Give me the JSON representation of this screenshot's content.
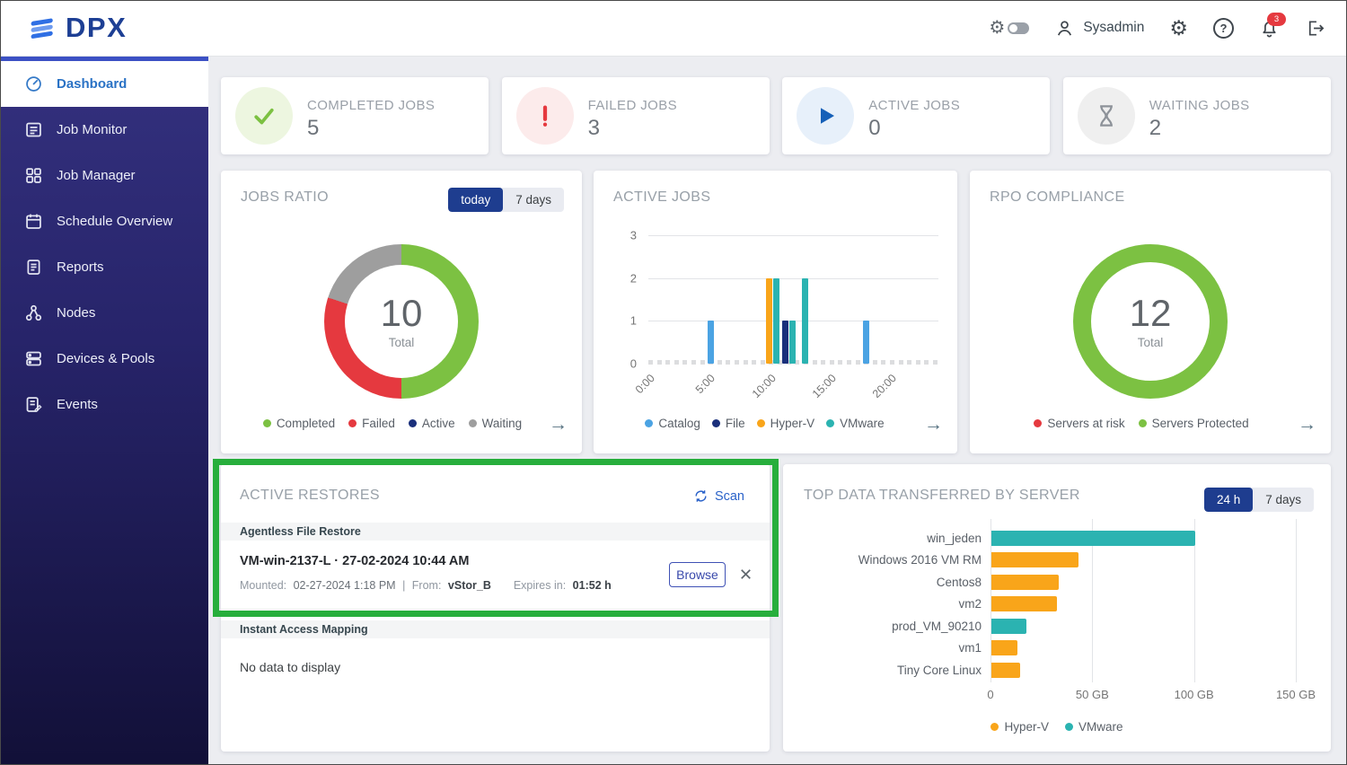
{
  "header": {
    "logo_text": "DPX",
    "user_name": "Sysadmin",
    "notification_badge": "3"
  },
  "sidebar": {
    "items": [
      {
        "label": "Dashboard",
        "icon": "gauge-icon",
        "active": true
      },
      {
        "label": "Job Monitor",
        "icon": "job-monitor-icon",
        "active": false
      },
      {
        "label": "Job Manager",
        "icon": "job-manager-icon",
        "active": false
      },
      {
        "label": "Schedule Overview",
        "icon": "schedule-icon",
        "active": false
      },
      {
        "label": "Reports",
        "icon": "reports-icon",
        "active": false
      },
      {
        "label": "Nodes",
        "icon": "nodes-icon",
        "active": false
      },
      {
        "label": "Devices & Pools",
        "icon": "devices-icon",
        "active": false
      },
      {
        "label": "Events",
        "icon": "events-icon",
        "active": false
      }
    ]
  },
  "stat_cards": [
    {
      "label": "COMPLETED JOBS",
      "value": "5",
      "icon": "check-icon",
      "color": "#7cc142",
      "tint": "#edf6e0"
    },
    {
      "label": "FAILED JOBS",
      "value": "3",
      "icon": "exclamation-icon",
      "color": "#e5393f",
      "tint": "#fcebeb"
    },
    {
      "label": "ACTIVE JOBS",
      "value": "0",
      "icon": "play-icon",
      "color": "#1660b8",
      "tint": "#e7f0fa"
    },
    {
      "label": "WAITING JOBS",
      "value": "2",
      "icon": "hourglass-icon",
      "color": "#8d9299",
      "tint": "#efefef"
    }
  ],
  "jobs_ratio": {
    "title": "JOBS RATIO",
    "toggle": [
      "today",
      "7 days"
    ],
    "toggle_selected": "today",
    "total": "10",
    "total_label": "Total",
    "chart_data": {
      "type": "donut",
      "segments": [
        {
          "label": "Completed",
          "value": 5,
          "color": "#7cc142"
        },
        {
          "label": "Failed",
          "value": 3,
          "color": "#e5393f"
        },
        {
          "label": "Active",
          "value": 0,
          "color": "#1a2f7b"
        },
        {
          "label": "Waiting",
          "value": 2,
          "color": "#9e9e9e"
        }
      ]
    }
  },
  "active_jobs": {
    "title": "ACTIVE JOBS",
    "chart_data": {
      "type": "bar",
      "ylim": [
        0,
        3
      ],
      "y_ticks": [
        0,
        1,
        2,
        3
      ],
      "hours_span": 24,
      "x_ticks": [
        {
          "hour": 0,
          "label": "0:00"
        },
        {
          "hour": 5,
          "label": "5:00"
        },
        {
          "hour": 10,
          "label": "10:00"
        },
        {
          "hour": 15,
          "label": "15:00"
        },
        {
          "hour": 20,
          "label": "20:00"
        }
      ],
      "series": [
        {
          "name": "Catalog",
          "color": "#4ba3e3"
        },
        {
          "name": "File",
          "color": "#1a2f7b"
        },
        {
          "name": "Hyper-V",
          "color": "#f9a51a"
        },
        {
          "name": "VMware",
          "color": "#2bb3b1"
        }
      ],
      "bars": [
        {
          "hour": 5.2,
          "series": "Catalog",
          "value": 1
        },
        {
          "hour": 10.0,
          "series": "Hyper-V",
          "value": 2
        },
        {
          "hour": 10.6,
          "series": "VMware",
          "value": 2
        },
        {
          "hour": 11.3,
          "series": "File",
          "value": 1
        },
        {
          "hour": 11.9,
          "series": "VMware",
          "value": 1
        },
        {
          "hour": 13.0,
          "series": "VMware",
          "value": 2
        },
        {
          "hour": 18.0,
          "series": "Catalog",
          "value": 1
        }
      ]
    }
  },
  "rpo_compliance": {
    "title": "RPO COMPLIANCE",
    "total": "12",
    "total_label": "Total",
    "chart_data": {
      "type": "donut",
      "segments": [
        {
          "label": "Servers at risk",
          "value": 0,
          "color": "#e5393f"
        },
        {
          "label": "Servers Protected",
          "value": 12,
          "color": "#7cc142"
        }
      ]
    }
  },
  "active_restores": {
    "title": "ACTIVE RESTORES",
    "scan_label": "Scan",
    "section1_header": "Agentless File Restore",
    "restore": {
      "title": "VM-win-2137-L · 27-02-2024 10:44 AM",
      "mounted_label": "Mounted:",
      "mounted_value": "02-27-2024 1:18 PM",
      "separator": "|",
      "from_label": "From:",
      "from_value": "vStor_B",
      "expires_label": "Expires in:",
      "expires_value": "01:52 h",
      "browse_label": "Browse"
    },
    "section2_header": "Instant Access Mapping",
    "empty_text": "No data to display"
  },
  "top_data": {
    "title": "TOP DATA TRANSFERRED BY SERVER",
    "toggle": [
      "24 h",
      "7 days"
    ],
    "toggle_selected": "24 h",
    "chart_data": {
      "type": "bar-horizontal",
      "categories": [
        "win_jeden",
        "Windows 2016 VM RM",
        "Centos8",
        "vm2",
        "prod_VM_90210",
        "vm1",
        "Tiny Core Linux"
      ],
      "values_gb": [
        100,
        43,
        33,
        32,
        17,
        13,
        14
      ],
      "series": [
        "VMware",
        "Hyper-V",
        "Hyper-V",
        "Hyper-V",
        "VMware",
        "Hyper-V",
        "Hyper-V"
      ],
      "x_ticks": [
        "0",
        "50 GB",
        "100 GB",
        "150 GB"
      ],
      "xlim_gb": [
        0,
        150
      ],
      "legend": [
        {
          "name": "Hyper-V",
          "color": "#f9a51a"
        },
        {
          "name": "VMware",
          "color": "#2bb3b1"
        }
      ]
    }
  },
  "annotation": {
    "color": "#27ae3c"
  }
}
